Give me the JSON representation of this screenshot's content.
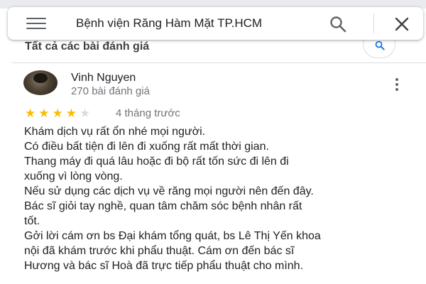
{
  "search": {
    "query": "Bệnh viện Răng Hàm Mặt TP.HCM",
    "menu_icon": "menu-icon",
    "search_icon": "search-icon",
    "close_icon": "close-icon"
  },
  "reviews_section": {
    "title": "Tất cả các bài đánh giá",
    "search_icon": "search-icon"
  },
  "review": {
    "reviewer_name": "Vinh Nguyen",
    "review_count": "270 bài đánh giá",
    "rating": 4,
    "max_rating": 5,
    "date": "4 tháng trước",
    "text_lines": [
      "Khám dịch vụ rất ổn nhé mọi người.",
      "Có điều bất tiện đi lên đi xuống rất mất thời gian.",
      "Thang máy đi quá lâu hoặc đi bộ rất tốn sức đi lên đi",
      "xuống vì lòng vòng.",
      "Nếu sử dụng các dịch vụ về răng mọi người nên đến đây.",
      "Bác sĩ giỏi tay nghề, quan tâm chăm sóc bệnh nhân rất",
      "tốt.",
      "Gởi lời cám ơn bs Đại khám tổng quát, bs Lê Thị Yến khoa",
      "nội đã khám trước khi phẩu thuật. Cám ơn đến bác sĩ",
      "Hương và bác sĩ Hoà đã trực tiếp phẩu thuật cho mình."
    ]
  },
  "colors": {
    "star_filled": "#fbbc04",
    "star_empty": "#dadce0",
    "accent_blue": "#1a73e8",
    "text_primary": "#202124",
    "text_secondary": "#70757a"
  }
}
